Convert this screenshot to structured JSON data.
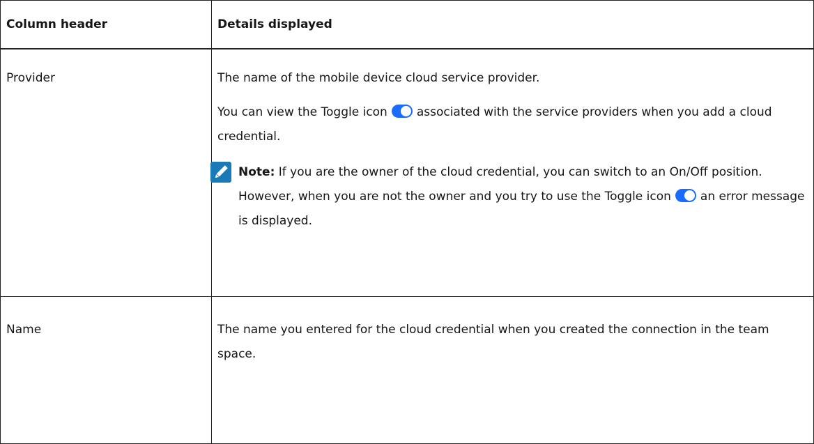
{
  "table": {
    "headers": [
      "Column header",
      "Details displayed"
    ],
    "rows": [
      {
        "column": "Provider",
        "para1": "The name of the mobile device cloud service provider.",
        "para2_before": "You can view the Toggle icon",
        "para2_after": "associated with the service providers when you add a cloud credential.",
        "note_label": "Note:",
        "note_before": "If you are the owner of the cloud credential, you can switch to an On/Off position. However, when you are not the owner and you try to use the Toggle icon",
        "note_after": "an error message is displayed."
      },
      {
        "column": "Name",
        "details": "The name you entered for the cloud credential when you created the connection in the team space."
      }
    ]
  },
  "colors": {
    "toggle_blue": "#1a6cff",
    "note_icon_bg": "#1a7ab8"
  },
  "icons": [
    "toggle-icon",
    "note-pencil-icon"
  ]
}
